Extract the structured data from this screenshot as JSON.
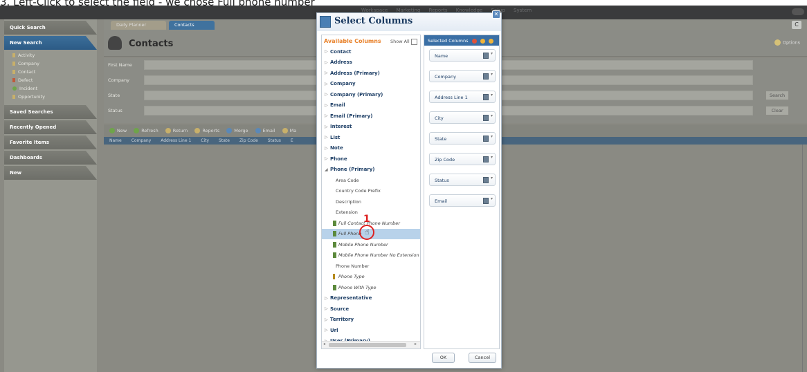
{
  "caption": "3. Left-Click to select the field - we chose Full phone number",
  "topbar": {
    "tabs": [
      "Workspace",
      "Marketing",
      "Reports",
      "Knowledge",
      "Setup",
      "System"
    ]
  },
  "sidebar": {
    "quick_search": "Quick Search",
    "new_search": "New Search",
    "items": [
      {
        "label": "Activity",
        "icon": "activity-icon"
      },
      {
        "label": "Company",
        "icon": "company-icon"
      },
      {
        "label": "Contact",
        "icon": "contact-icon"
      },
      {
        "label": "Defect",
        "icon": "defect-icon"
      },
      {
        "label": "Incident",
        "icon": "incident-icon"
      },
      {
        "label": "Opportunity",
        "icon": "opportunity-icon"
      }
    ],
    "sections": [
      "Saved Searches",
      "Recently Opened",
      "Favorite Items",
      "Dashboards",
      "New"
    ]
  },
  "tabs": {
    "daily_planner": "Daily Planner",
    "contacts": "Contacts"
  },
  "header": {
    "title": "Contacts",
    "options": "Options"
  },
  "form": {
    "first_name": "First Name",
    "company": "Company",
    "state": "State",
    "status": "Status",
    "search_btn": "Search",
    "clear_btn": "Clear"
  },
  "toolbar": {
    "new": "New",
    "refresh": "Refresh",
    "return": "Return",
    "reports": "Reports",
    "merge": "Merge",
    "email": "Email",
    "more": "Ma"
  },
  "columns_bar": [
    "Name",
    "Company",
    "Address Line 1",
    "City",
    "State",
    "Zip Code",
    "Status",
    "E"
  ],
  "modal": {
    "title": "Select Columns",
    "available_title": "Available Columns",
    "show_all": "Show All",
    "selected_title": "Selected Columns",
    "ok": "OK",
    "cancel": "Cancel",
    "tree": [
      {
        "type": "node",
        "label": "Contact",
        "expanded": false
      },
      {
        "type": "node",
        "label": "Address",
        "expanded": false
      },
      {
        "type": "node",
        "label": "Address (Primary)",
        "expanded": false
      },
      {
        "type": "node",
        "label": "Company",
        "expanded": false
      },
      {
        "type": "node",
        "label": "Company (Primary)",
        "expanded": false
      },
      {
        "type": "node",
        "label": "Email",
        "expanded": false
      },
      {
        "type": "node",
        "label": "Email (Primary)",
        "expanded": false
      },
      {
        "type": "node",
        "label": "Interest",
        "expanded": false
      },
      {
        "type": "node",
        "label": "List",
        "expanded": false
      },
      {
        "type": "node",
        "label": "Note",
        "expanded": false
      },
      {
        "type": "node",
        "label": "Phone",
        "expanded": false
      },
      {
        "type": "node",
        "label": "Phone (Primary)",
        "expanded": true
      },
      {
        "type": "leaf",
        "label": "Area Code"
      },
      {
        "type": "leaf",
        "label": "Country Code Prefix"
      },
      {
        "type": "leaf",
        "label": "Description"
      },
      {
        "type": "leaf",
        "label": "Extension"
      },
      {
        "type": "leaf-icon",
        "label": "Full Contact Phone Number"
      },
      {
        "type": "leaf-icon",
        "label": "Full Phone",
        "selected": true
      },
      {
        "type": "leaf-icon",
        "label": "Mobile Phone Number"
      },
      {
        "type": "leaf-icon",
        "label": "Mobile Phone Number No Extension"
      },
      {
        "type": "leaf",
        "label": "Phone Number"
      },
      {
        "type": "leaf-key",
        "label": "Phone Type"
      },
      {
        "type": "leaf-icon",
        "label": "Phone With Type"
      },
      {
        "type": "node",
        "label": "Representative",
        "expanded": false
      },
      {
        "type": "node",
        "label": "Source",
        "expanded": false
      },
      {
        "type": "node",
        "label": "Territory",
        "expanded": false
      },
      {
        "type": "node",
        "label": "Url",
        "expanded": false
      },
      {
        "type": "node",
        "label": "User (Primary)",
        "expanded": false
      }
    ],
    "selected_columns": [
      "Name",
      "Company",
      "Address Line 1",
      "City",
      "State",
      "Zip Code",
      "Status",
      "Email"
    ]
  },
  "annotation": {
    "step_marker": "1"
  }
}
